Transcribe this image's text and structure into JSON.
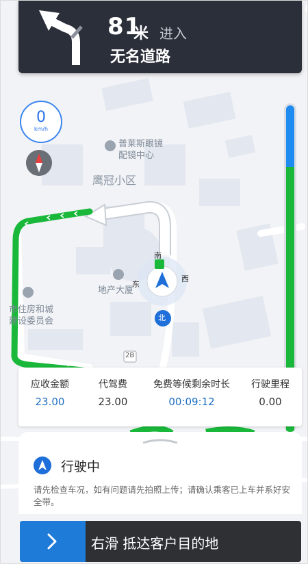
{
  "nav": {
    "distance": "81",
    "distance_unit": "米",
    "action": "进入",
    "road": "无名道路"
  },
  "speed": {
    "value": "0",
    "unit": "km/h"
  },
  "map": {
    "poi_glasses": "普莱斯眼镜",
    "poi_glasses2": "配镜中心",
    "area": "鹰冠小区",
    "poi_estate": "地产大厦",
    "poi_housing1": "市住房和城",
    "poi_housing2": "建设委员会",
    "compass_s": "南",
    "compass_w": "西",
    "compass_e": "东",
    "compass_n": "北",
    "route_badge": "2B"
  },
  "stats": [
    {
      "label": "应收金额",
      "value": "23.00"
    },
    {
      "label": "代驾费",
      "value": "23.00"
    },
    {
      "label": "免费等候剩余时长",
      "value": "00:09:12"
    },
    {
      "label": "行驶里程",
      "value": "0.00"
    }
  ],
  "panel": {
    "status": "行驶中",
    "notice": "请先检查车况，如有问题请先拍照上传；请确认乘客已上车并系好安全带。"
  },
  "slider": {
    "label": "右滑  抵达客户目的地"
  },
  "colors": {
    "accent_blue": "#1e7bd8",
    "route_green": "#19b83a",
    "nav_bg": "#2b2f39"
  }
}
